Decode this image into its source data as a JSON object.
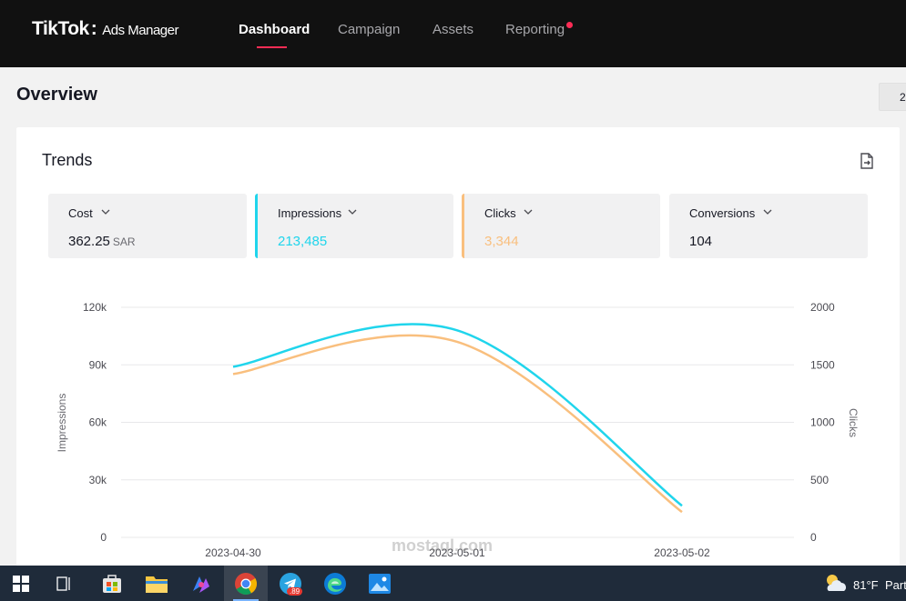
{
  "header": {
    "brand": "TikTok",
    "brand_sub": "Ads Manager",
    "nav": [
      {
        "label": "Dashboard"
      },
      {
        "label": "Campaign"
      },
      {
        "label": "Assets"
      },
      {
        "label": "Reporting"
      }
    ]
  },
  "overview": {
    "title": "Overview",
    "date_button_text": "2"
  },
  "trends": {
    "title": "Trends",
    "metrics": [
      {
        "label": "Cost",
        "value": "362.25",
        "unit": "SAR"
      },
      {
        "label": "Impressions",
        "value": "213,485",
        "unit": ""
      },
      {
        "label": "Clicks",
        "value": "3,344",
        "unit": ""
      },
      {
        "label": "Conversions",
        "value": "104",
        "unit": ""
      }
    ]
  },
  "chart_data": {
    "type": "line",
    "x": [
      "2023-04-30",
      "2023-05-01",
      "2023-05-02"
    ],
    "series": [
      {
        "name": "Impressions",
        "axis": "left",
        "color": "#20d5ec",
        "values": [
          89000,
          108000,
          16500
        ]
      },
      {
        "name": "Clicks",
        "axis": "right",
        "color": "#f9bf7e",
        "values": [
          1420,
          1700,
          220
        ]
      }
    ],
    "ylabel_left": "Impressions",
    "ylabel_right": "Clicks",
    "yticks_left": [
      "120k",
      "90k",
      "60k",
      "30k",
      "0"
    ],
    "yticks_right": [
      "2000",
      "1500",
      "1000",
      "500",
      "0"
    ],
    "ylim_left": [
      0,
      120000
    ],
    "ylim_right": [
      0,
      2000
    ],
    "grid": true
  },
  "taskbar": {
    "temperature": "81°F",
    "weather_text": "Part",
    "telegram_badge": ".89"
  },
  "watermark": "mostaql.com",
  "colors": {
    "accent": "#fe2c55",
    "impressions": "#20d5ec",
    "clicks": "#f9bf7e"
  }
}
